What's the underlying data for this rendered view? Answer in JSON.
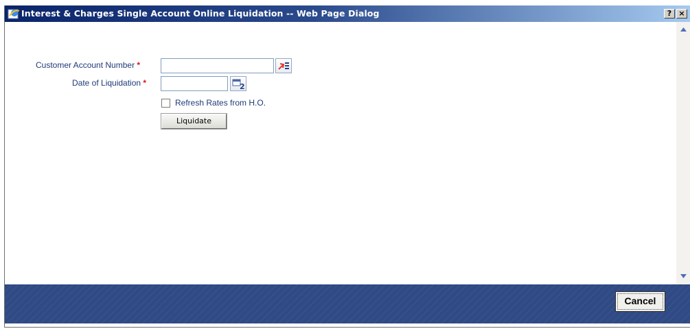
{
  "window": {
    "title": "Interest & Charges Single Account Online Liquidation -- Web Page Dialog",
    "help_label": "?",
    "close_label": "×"
  },
  "form": {
    "customer_account_label": "Customer Account Number",
    "customer_account_value": "",
    "date_label": "Date of Liquidation",
    "date_value": "",
    "required_marker": "*",
    "refresh_rates_label": "Refresh Rates from H.O.",
    "refresh_rates_checked": false,
    "liquidate_label": "Liquidate",
    "calendar_icon_number": "2"
  },
  "footer": {
    "cancel_label": "Cancel"
  },
  "colors": {
    "label": "#1f3a78",
    "required": "#e01010",
    "footer": "#2f4a85",
    "titlebar_start": "#0a246a",
    "titlebar_end": "#a6caf0"
  }
}
